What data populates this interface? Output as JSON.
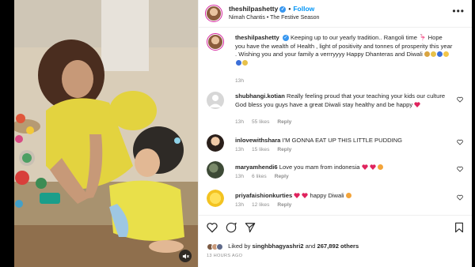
{
  "post": {
    "username": "theshilpashetty",
    "follow_label": "Follow",
    "audio": "Nimah Chantis • The Festive Season",
    "more_icon": "more-dots-icon"
  },
  "caption": {
    "username": "theshilpashetty",
    "text": "Keeping up to our yearly tradition.. Rangoli time 🦩 Hope you have the wealth of Health , light of positivity and tonnes of prosperity this year . Wishing you and your family a verrryyyy Happy Dhanteras and Diwali",
    "time": "13h"
  },
  "comments": [
    {
      "username": "shubhangi.kotian",
      "text": "Really feeling proud that your teaching your kids our culture God bless you guys have a great Diwali stay healthy and be happy",
      "time": "13h",
      "likes": "55 likes",
      "reply": "Reply"
    },
    {
      "username": "inlovewithshara",
      "text": "I'M GONNA EAT UP THIS LITTLE PUDDING",
      "time": "13h",
      "likes": "15 likes",
      "reply": "Reply"
    },
    {
      "username": "maryamhendi6",
      "text": "Love you mam from indonesia",
      "time": "13h",
      "likes": "6 likes",
      "reply": "Reply"
    },
    {
      "username": "priyafaishionkurties",
      "text": "happy Diwali",
      "time": "13h",
      "likes": "12 likes",
      "reply": "Reply"
    }
  ],
  "likes": {
    "prefix": "Liked by",
    "user": "singhbhagyashri2",
    "conjunction": "and",
    "count": "267,892 others"
  },
  "posted": "13 HOURS AGO",
  "colors": {
    "follow": "#0095f6",
    "heart": "#ed4956",
    "verified": "#3897f0",
    "story_ring": "#d6249f"
  }
}
